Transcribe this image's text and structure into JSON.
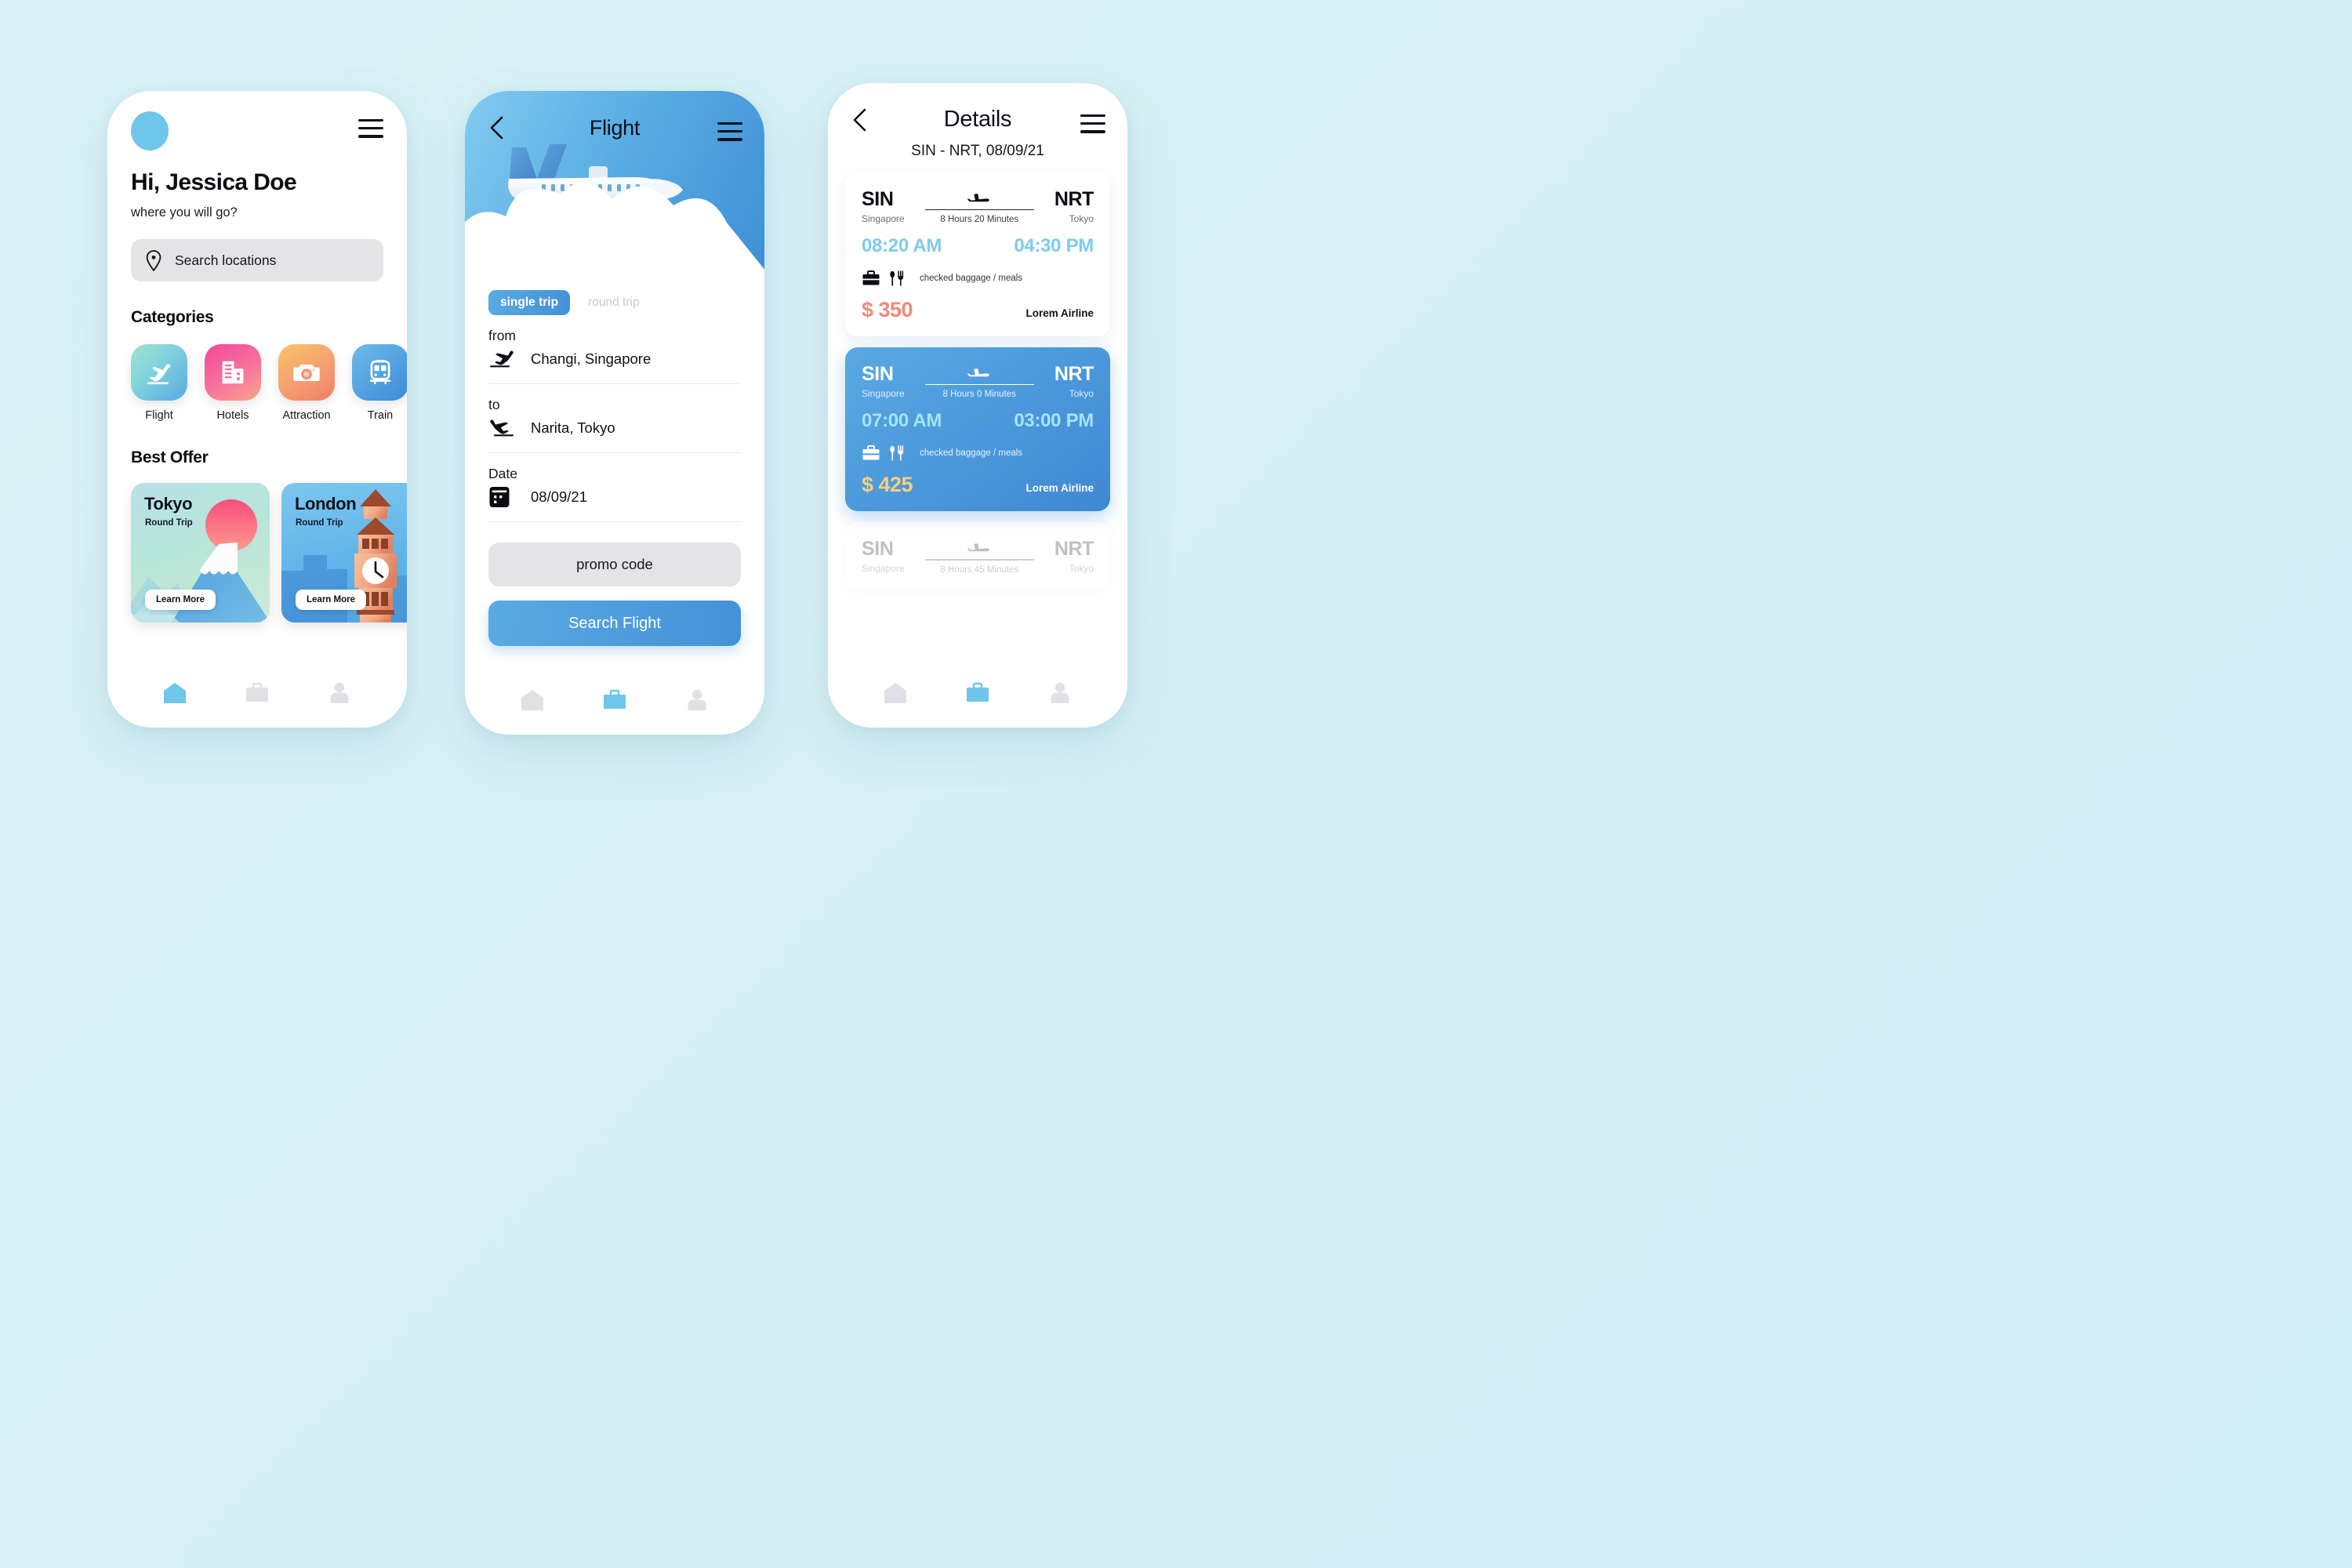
{
  "background_color": "#d5f0f5",
  "home": {
    "menu_icon": "hamburger-menu-icon",
    "avatar_icon": "user-avatar",
    "greeting": "Hi, Jessica Doe",
    "subgreeting": "where you will go?",
    "search": {
      "icon": "location-pin-icon",
      "placeholder": "Search locations",
      "value": ""
    },
    "categories_title": "Categories",
    "categories": [
      {
        "label": "Flight",
        "icon": "airplane-takeoff-icon",
        "color": "#7ed0dd"
      },
      {
        "label": "Hotels",
        "icon": "building-icon",
        "color": "#f6739b"
      },
      {
        "label": "Attraction",
        "icon": "camera-icon",
        "color": "#f59f70"
      },
      {
        "label": "Train",
        "icon": "train-icon",
        "color": "#4f9ede"
      }
    ],
    "best_offer_title": "Best Offer",
    "offers": [
      {
        "city": "Tokyo",
        "trip_type": "Round Trip",
        "cta": "Learn More",
        "theme": "mount-fuji"
      },
      {
        "city": "London",
        "trip_type": "Round Trip",
        "cta": "Learn More",
        "theme": "big-ben"
      }
    ],
    "nav": [
      {
        "icon": "home-icon",
        "active": true
      },
      {
        "icon": "briefcase-icon",
        "active": false
      },
      {
        "icon": "person-icon",
        "active": false
      }
    ]
  },
  "flight": {
    "back_icon": "chevron-left-icon",
    "title": "Flight",
    "menu_icon": "hamburger-menu-icon",
    "hero_icon": "airplane-illustration",
    "trip_types": [
      {
        "label": "single trip",
        "selected": true
      },
      {
        "label": "round trip",
        "selected": false
      }
    ],
    "fields": [
      {
        "label": "from",
        "icon": "airplane-takeoff-icon",
        "value": "Changi, Singapore"
      },
      {
        "label": "to",
        "icon": "airplane-landing-icon",
        "value": "Narita, Tokyo"
      },
      {
        "label": "Date",
        "icon": "calendar-icon",
        "value": "08/09/21"
      }
    ],
    "promo_placeholder": "promo code",
    "promo_value": "",
    "search_button": "Search Flight",
    "nav": [
      {
        "icon": "home-icon",
        "active": false
      },
      {
        "icon": "briefcase-icon",
        "active": true
      },
      {
        "icon": "person-icon",
        "active": false
      }
    ]
  },
  "details": {
    "back_icon": "chevron-left-icon",
    "title": "Details",
    "menu_icon": "hamburger-menu-icon",
    "subtitle": "SIN - NRT, 08/09/21",
    "amenities_label": "checked baggage / meals",
    "baggage_icon": "briefcase-icon",
    "meal_icon": "cutlery-icon",
    "plane_icon": "airplane-icon",
    "flights": [
      {
        "origin_code": "SIN",
        "origin_city": "Singapore",
        "dest_code": "NRT",
        "dest_city": "Tokyo",
        "duration": "8 Hours 20 Minutes",
        "depart_time": "08:20 AM",
        "arrive_time": "04:30 PM",
        "amenities": "checked baggage / meals",
        "price": "$ 350",
        "airline": "Lorem Airline",
        "state": "plain"
      },
      {
        "origin_code": "SIN",
        "origin_city": "Singapore",
        "dest_code": "NRT",
        "dest_city": "Tokyo",
        "duration": "8 Hours 0 Minutes",
        "depart_time": "07:00 AM",
        "arrive_time": "03:00 PM",
        "amenities": "checked baggage / meals",
        "price": "$ 425",
        "airline": "Lorem Airline",
        "state": "active"
      },
      {
        "origin_code": "SIN",
        "origin_city": "Singapore",
        "dest_code": "NRT",
        "dest_city": "Tokyo",
        "duration": "8 Hours 45 Minutes",
        "depart_time": "",
        "arrive_time": "",
        "amenities": "",
        "price": "",
        "airline": "",
        "state": "faded"
      }
    ],
    "nav": [
      {
        "icon": "home-icon",
        "active": false
      },
      {
        "icon": "briefcase-icon",
        "active": true
      },
      {
        "icon": "person-icon",
        "active": false
      }
    ]
  },
  "colors": {
    "accent_blue": "#4a97db",
    "light_blue": "#7ecbec",
    "price_coral": "#ef8a78",
    "price_gold": "#f5d07a",
    "nav_active": "#6ec6ea",
    "nav_inactive": "#e2e0e4"
  }
}
